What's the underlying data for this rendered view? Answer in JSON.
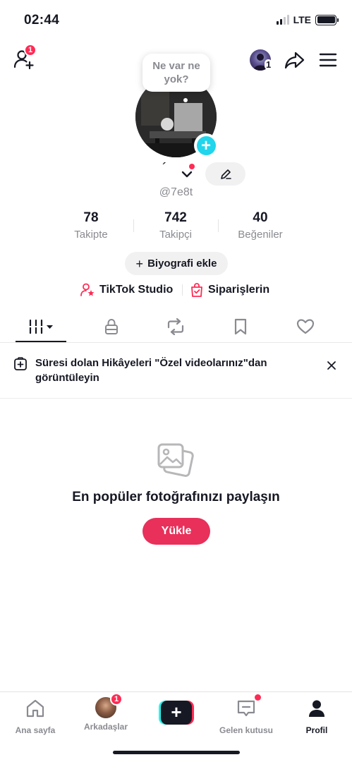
{
  "status_bar": {
    "time": "02:44",
    "network": "LTE"
  },
  "top_bar": {
    "add_friend_badge": "1",
    "switch_account_badge": "1"
  },
  "profile": {
    "bubble_text": "Ne var ne yok?",
    "display_name": "´",
    "handle": "@7e8t",
    "stats": [
      {
        "value": "78",
        "label": "Takipte"
      },
      {
        "value": "742",
        "label": "Takipçi"
      },
      {
        "value": "40",
        "label": "Beğeniler"
      }
    ],
    "bio_button": "Biyografi ekle",
    "links": [
      {
        "label": "TikTok Studio",
        "icon": "creator-star-icon"
      },
      {
        "label": "Siparişlerin",
        "icon": "shopping-bag-icon"
      }
    ]
  },
  "tabs": [
    {
      "icon": "videos-grid-icon",
      "active": true
    },
    {
      "icon": "lock-icon",
      "active": false
    },
    {
      "icon": "repost-icon",
      "active": false
    },
    {
      "icon": "bookmark-icon",
      "active": false
    },
    {
      "icon": "heart-icon",
      "active": false
    }
  ],
  "story_banner": {
    "text": "Süresi dolan Hikâyeleri \"Özel videolarınız\"dan görüntüleyin"
  },
  "empty_state": {
    "title": "En popüler fotoğrafınızı paylaşın",
    "button": "Yükle"
  },
  "bottom_nav": [
    {
      "label": "Ana sayfa",
      "icon": "home-icon",
      "active": false
    },
    {
      "label": "Arkadaşlar",
      "icon": "friends-avatar",
      "badge": "1",
      "active": false
    },
    {
      "label": "",
      "icon": "create-plus-icon",
      "active": false
    },
    {
      "label": "Gelen kutusu",
      "icon": "inbox-icon",
      "active": false
    },
    {
      "label": "Profil",
      "icon": "profile-icon",
      "active": true
    }
  ],
  "colors": {
    "accent": "#fe2c55",
    "upload": "#e8305a",
    "cyan": "#20d5ec",
    "muted": "#8a8b91"
  }
}
